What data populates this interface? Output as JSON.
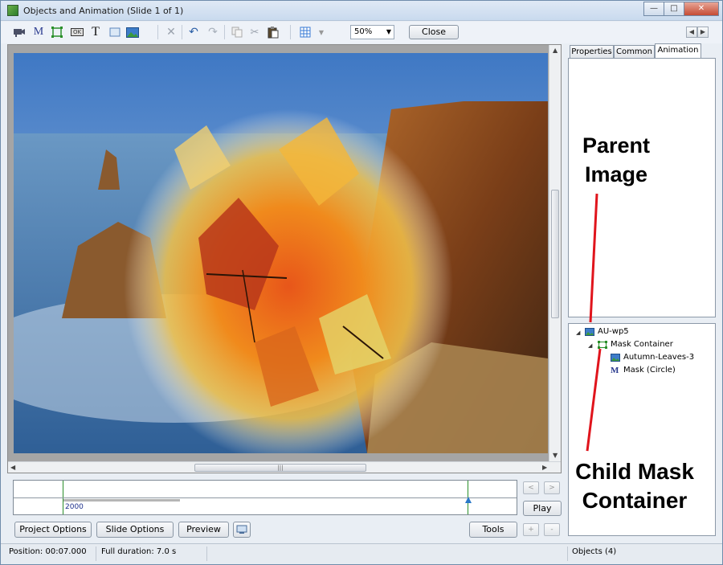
{
  "window": {
    "title": "Objects and Animation  (Slide 1 of 1)",
    "buttons": [
      "minimize",
      "maximize",
      "close"
    ]
  },
  "toolbar": {
    "icons": [
      "camera-icon",
      "mask-icon",
      "frame-icon",
      "ok-button-icon",
      "text-icon",
      "rectangle-icon",
      "image-icon",
      "delete-icon",
      "undo-icon",
      "redo-icon",
      "copy-icon",
      "cut-icon",
      "paste-icon",
      "grid-icon"
    ],
    "mask_glyph": "M",
    "text_glyph": "T",
    "ok_glyph": "OK",
    "zoom": "50%",
    "close_label": "Close"
  },
  "timeline": {
    "time_label": "2000"
  },
  "buttons": {
    "play": "Play",
    "project_options": "Project Options",
    "slide_options": "Slide Options",
    "preview": "Preview",
    "tools": "Tools",
    "nav_prev": "<",
    "nav_next": ">",
    "add": "+",
    "remove": "-"
  },
  "panel": {
    "tabs": [
      "Properties",
      "Common",
      "Animation"
    ],
    "active_tab": "Animation",
    "tree": [
      {
        "label": "AU-wp5",
        "icon": "image-icon",
        "level": 0
      },
      {
        "label": "Mask Container",
        "icon": "frame-icon",
        "level": 1
      },
      {
        "label": "Autumn-Leaves-3",
        "icon": "image-icon",
        "level": 2
      },
      {
        "label": "Mask (Circle)",
        "icon": "mask-icon",
        "level": 2
      }
    ]
  },
  "annotations": {
    "parent_line1": "Parent",
    "parent_line2": "Image",
    "child_line1": "Child Mask",
    "child_line2": "Container"
  },
  "status": {
    "position": "Position:  00:07.000",
    "duration": "Full duration:  7.0 s",
    "objects": "Objects (4)"
  },
  "colors": {
    "accent": "#2a78c8",
    "annotation_line": "#e0141c",
    "timeline_marker": "#2a8f2a"
  }
}
